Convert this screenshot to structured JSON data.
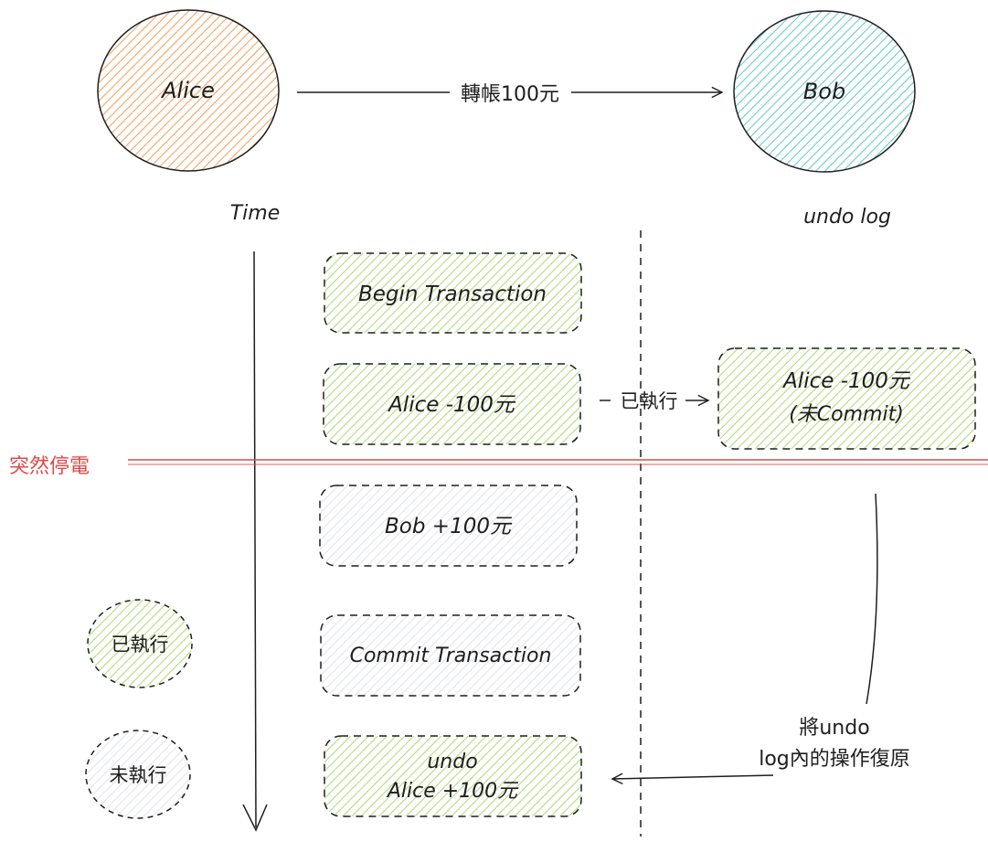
{
  "colors": {
    "alice_fill": "#f59d57",
    "bob_fill": "#5ec8d2",
    "executed_fill": "#a9dc6f",
    "pending_fill": "#dfe3e8",
    "stroke": "#1e1e1e",
    "power_line": "#e04848",
    "power_text": "#e04848"
  },
  "nodes": {
    "alice": "Alice",
    "bob": "Bob"
  },
  "transfer_label": "轉帳100元",
  "time_label": "Time",
  "undo_log_label": "undo log",
  "power_outage_label": "突然停電",
  "steps": [
    {
      "id": "begin",
      "lines": [
        "Begin Transaction"
      ],
      "status": "executed"
    },
    {
      "id": "alice-minus",
      "lines": [
        "Alice -100元"
      ],
      "status": "executed"
    },
    {
      "id": "bob-plus",
      "lines": [
        "Bob +100元"
      ],
      "status": "pending"
    },
    {
      "id": "commit",
      "lines": [
        "Commit Transaction"
      ],
      "status": "pending"
    },
    {
      "id": "undo",
      "lines": [
        "undo",
        "Alice +100元"
      ],
      "status": "executed"
    }
  ],
  "undo_log_entry": {
    "lines": [
      "Alice -100元",
      "(未Commit)"
    ]
  },
  "executed_arrow_label": "已執行",
  "legend": {
    "executed": "已執行",
    "pending": "未執行"
  },
  "restore_label": {
    "lines": [
      "將undo",
      "log內的操作復原"
    ]
  }
}
